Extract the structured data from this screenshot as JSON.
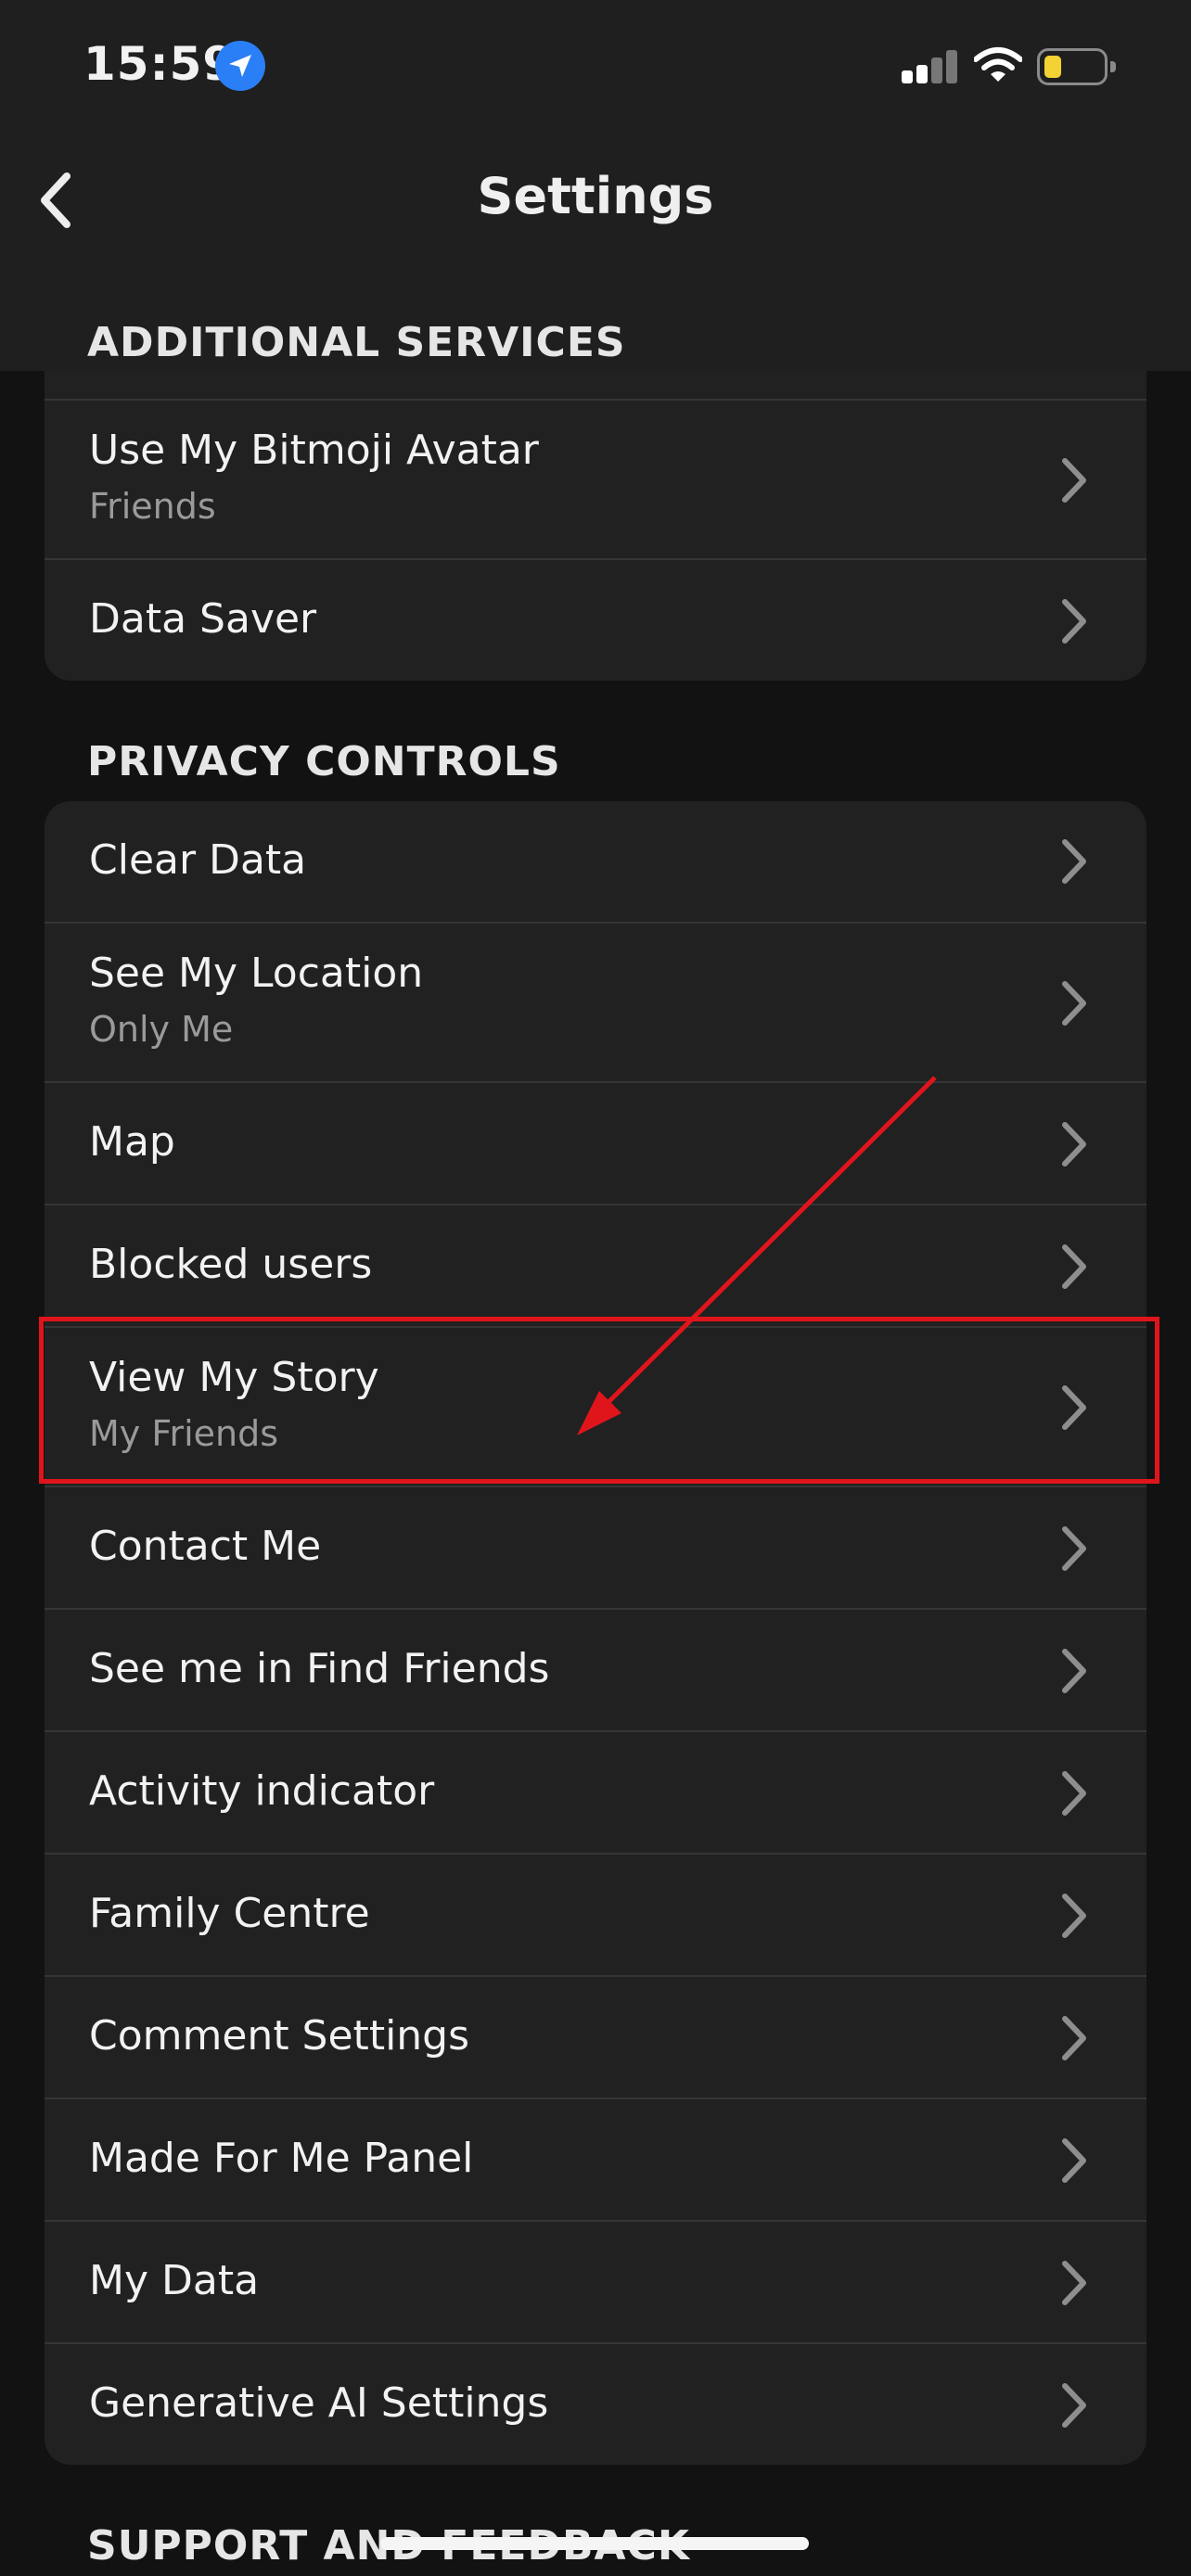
{
  "status_bar": {
    "time": "15:59"
  },
  "header": {
    "title": "Settings"
  },
  "sections": {
    "additional_services": {
      "title": "ADDITIONAL SERVICES",
      "items": [
        {
          "label": "Use My Bitmoji Avatar",
          "sublabel": "Friends"
        },
        {
          "label": "Data Saver"
        }
      ]
    },
    "privacy_controls": {
      "title": "PRIVACY CONTROLS",
      "items": [
        {
          "label": "Clear Data"
        },
        {
          "label": "See My Location",
          "sublabel": "Only Me"
        },
        {
          "label": "Map"
        },
        {
          "label": "Blocked users"
        },
        {
          "label": "View My Story",
          "sublabel": "My Friends"
        },
        {
          "label": "Contact Me"
        },
        {
          "label": "See me in Find Friends"
        },
        {
          "label": "Activity indicator"
        },
        {
          "label": "Family Centre"
        },
        {
          "label": "Comment Settings"
        },
        {
          "label": "Made For Me Panel"
        },
        {
          "label": "My Data"
        },
        {
          "label": "Generative AI Settings"
        }
      ]
    },
    "support_feedback": {
      "title": "SUPPORT AND FEEDBACK"
    }
  },
  "annotation": {
    "color": "#e0151b",
    "highlighted_item": "View My Story"
  },
  "icons": {
    "back": "chevron-left-icon",
    "row_chevron": "chevron-right-icon",
    "location": "location-arrow-icon",
    "signal": "cellular-signal-icon",
    "wifi": "wifi-icon",
    "battery": "battery-icon"
  },
  "battery_level": 0.2
}
